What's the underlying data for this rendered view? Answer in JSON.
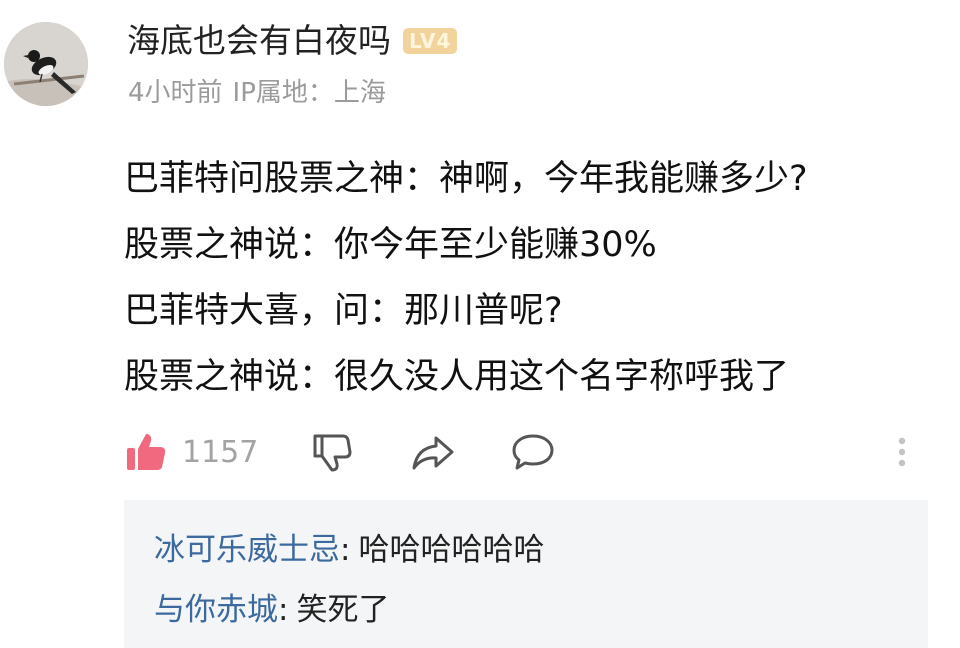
{
  "post": {
    "author": "海底也会有白夜吗",
    "level_badge": "LV4",
    "time": "4小时前",
    "ip_location": "IP属地：上海",
    "content_lines": [
      "巴菲特问股票之神：神啊，今年我能赚多少?",
      "股票之神说：你今年至少能赚30%",
      "巴菲特大喜，问：那川普呢?",
      "股票之神说：很久没人用这个名字称呼我了"
    ]
  },
  "actions": {
    "like_icon": "thumbs-up-icon",
    "like_count": "1157",
    "dislike_icon": "thumbs-down-icon",
    "share_icon": "share-icon",
    "comment_icon": "comment-bubble-icon",
    "more_icon": "more-vertical-icon"
  },
  "replies": [
    {
      "name": "冰可乐威士忌",
      "sep": ":",
      "text": "哈哈哈哈哈哈"
    },
    {
      "name": "与你赤城",
      "sep": ":",
      "text": "笑死了"
    }
  ],
  "colors": {
    "like_accent": "#f0697e",
    "reply_name": "#3d6a9e",
    "badge_bg": "#f2d39c",
    "meta_gray": "#9b9b9b",
    "reply_bg": "#f4f5f7"
  }
}
